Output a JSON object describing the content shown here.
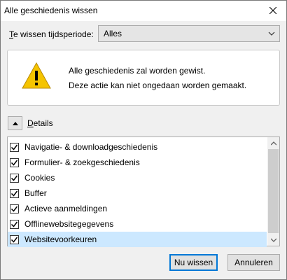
{
  "window": {
    "title": "Alle geschiedenis wissen"
  },
  "period": {
    "label_prefix": "T",
    "label_rest": "e wissen tijdsperiode:",
    "selected": "Alles"
  },
  "warning": {
    "line1": "Alle geschiedenis zal worden gewist.",
    "line2": "Deze actie kan niet ongedaan worden gemaakt."
  },
  "details": {
    "label_prefix": "D",
    "label_rest": "etails"
  },
  "items": [
    {
      "label": "Navigatie- & downloadgeschiedenis",
      "checked": true
    },
    {
      "label": "Formulier- & zoekgeschiedenis",
      "checked": true
    },
    {
      "label": "Cookies",
      "checked": true
    },
    {
      "label": "Buffer",
      "checked": true
    },
    {
      "label": "Actieve aanmeldingen",
      "checked": true
    },
    {
      "label": "Offlinewebsitegegevens",
      "checked": true
    },
    {
      "label": "Websitevoorkeuren",
      "checked": true,
      "selected": true
    }
  ],
  "buttons": {
    "primary": "Nu wissen",
    "secondary": "Annuleren"
  },
  "colors": {
    "selected_row": "#cce8ff",
    "accent": "#0078d7",
    "warning_yellow": "#f5c400"
  }
}
